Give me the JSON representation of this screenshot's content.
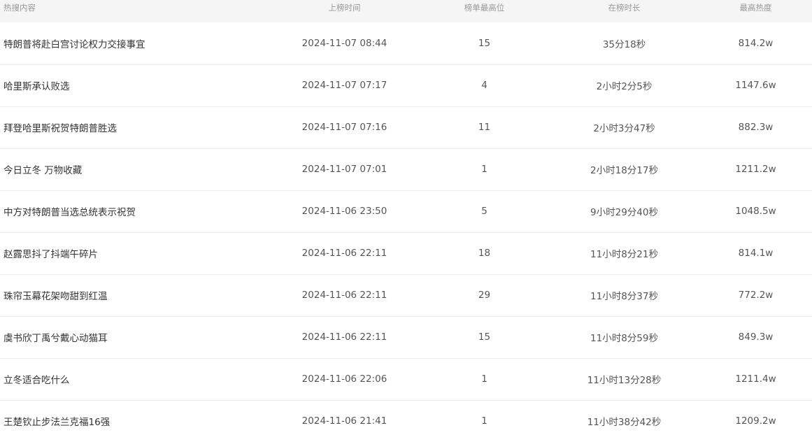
{
  "table": {
    "headers": {
      "title": "热搜内容",
      "time": "上榜时间",
      "rank": "榜单最高位",
      "duration": "在榜时长",
      "heat": "最高热度"
    },
    "rows": [
      {
        "title": "特朗普将赴白宫讨论权力交接事宜",
        "time": "2024-11-07 08:44",
        "rank": "15",
        "duration": "35分18秒",
        "heat": "814.2w"
      },
      {
        "title": "哈里斯承认败选",
        "time": "2024-11-07 07:17",
        "rank": "4",
        "duration": "2小时2分5秒",
        "heat": "1147.6w"
      },
      {
        "title": "拜登哈里斯祝贺特朗普胜选",
        "time": "2024-11-07 07:16",
        "rank": "11",
        "duration": "2小时3分47秒",
        "heat": "882.3w"
      },
      {
        "title": "今日立冬 万物收藏",
        "time": "2024-11-07 07:01",
        "rank": "1",
        "duration": "2小时18分17秒",
        "heat": "1211.2w"
      },
      {
        "title": "中方对特朗普当选总统表示祝贺",
        "time": "2024-11-06 23:50",
        "rank": "5",
        "duration": "9小时29分40秒",
        "heat": "1048.5w"
      },
      {
        "title": "赵露思抖了抖端午碎片",
        "time": "2024-11-06 22:11",
        "rank": "18",
        "duration": "11小时8分21秒",
        "heat": "814.1w"
      },
      {
        "title": "珠帘玉幕花架吻甜到红温",
        "time": "2024-11-06 22:11",
        "rank": "29",
        "duration": "11小时8分37秒",
        "heat": "772.2w"
      },
      {
        "title": "虞书欣丁禹兮戴心动猫耳",
        "time": "2024-11-06 22:11",
        "rank": "15",
        "duration": "11小时8分59秒",
        "heat": "849.3w"
      },
      {
        "title": "立冬适合吃什么",
        "time": "2024-11-06 22:06",
        "rank": "1",
        "duration": "11小时13分28秒",
        "heat": "1211.4w"
      },
      {
        "title": "王楚钦止步法兰克福16强",
        "time": "2024-11-06 21:41",
        "rank": "1",
        "duration": "11小时38分42秒",
        "heat": "1209.2w"
      }
    ]
  }
}
